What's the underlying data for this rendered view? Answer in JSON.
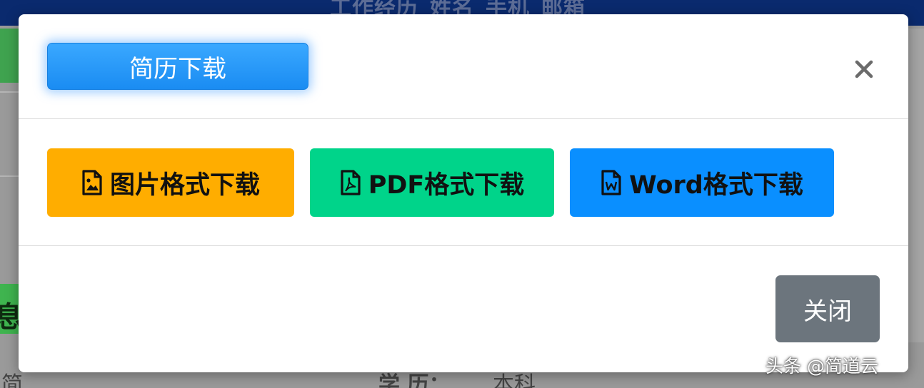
{
  "background": {
    "topbar_title": "工作经历_姓名_手机_邮箱",
    "left_char": "息",
    "bottom_left_text": "简",
    "bottom_mid_label": "学 历：",
    "bottom_mid_value": "本科"
  },
  "modal": {
    "title": "简历下载",
    "buttons": {
      "image_label": "图片格式下载",
      "pdf_label": "PDF格式下载",
      "word_label": "Word格式下载"
    },
    "close_label": "关闭"
  },
  "watermark": "头条 @简道云",
  "colors": {
    "title_blue": "#1a8cf2",
    "image_orange": "#ffad00",
    "pdf_green": "#00d48a",
    "word_blue": "#0a8fff",
    "close_gray": "#6c757d"
  },
  "icons": {
    "image": "file-image-icon",
    "pdf": "file-pdf-icon",
    "word": "file-word-icon",
    "close": "close-icon"
  }
}
